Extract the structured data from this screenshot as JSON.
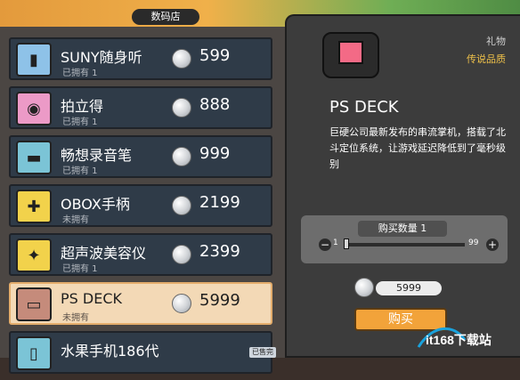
{
  "shop": {
    "title": "数码店"
  },
  "items": [
    {
      "name": "SUNY随身听",
      "owned": "已拥有 1",
      "price": "599",
      "thumb_color": "#8ec2e8",
      "icon": "walkman-icon"
    },
    {
      "name": "拍立得",
      "owned": "已拥有 1",
      "price": "888",
      "thumb_color": "#ec9ac7",
      "icon": "instant-camera-icon"
    },
    {
      "name": "畅想录音笔",
      "owned": "已拥有 1",
      "price": "999",
      "thumb_color": "#7bc4d6",
      "icon": "recorder-pen-icon"
    },
    {
      "name": "OBOX手柄",
      "owned": "未拥有",
      "price": "2199",
      "thumb_color": "#f2d24b",
      "icon": "gamepad-icon"
    },
    {
      "name": "超声波美容仪",
      "owned": "已拥有 1",
      "price": "2399",
      "thumb_color": "#f2d24b",
      "icon": "beauty-device-icon"
    },
    {
      "name": "PS DECK",
      "owned": "未拥有",
      "price": "5999",
      "thumb_color": "#c58b7b",
      "icon": "handheld-console-icon",
      "selected": true
    },
    {
      "name": "水果手机186代",
      "owned": "",
      "price": "",
      "thumb_color": "#7bc4d6",
      "icon": "phone-icon"
    }
  ],
  "partial_badge": "已售完",
  "detail": {
    "category": "礼物",
    "rarity": "传说品质",
    "title": "PS DECK",
    "description": "巨硬公司最新发布的串流掌机，搭载了北斗定位系统，让游戏延迟降低到了毫秒级别",
    "buy_quantity_label": "购买数量 1",
    "quantity": {
      "min": "1",
      "max": "99",
      "value": 1
    },
    "total": "5999",
    "buy_button": "购买"
  },
  "logo_text": "it168下载站",
  "colors": {
    "accent": "#f2a33a",
    "selected_row": "#f3d9b6",
    "rarity": "#f0c24a"
  }
}
